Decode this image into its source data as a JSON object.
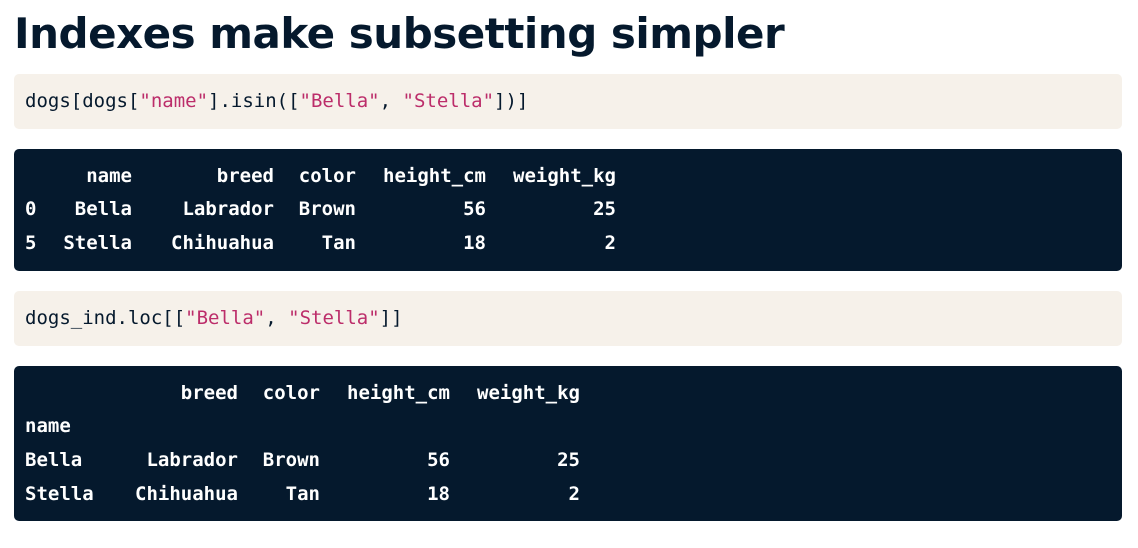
{
  "title": "Indexes make subsetting simpler",
  "code1": {
    "prefix": "dogs[dogs[",
    "key": "\"name\"",
    "mid": "].isin([",
    "val1": "\"Bella\"",
    "sep": ", ",
    "val2": "\"Stella\"",
    "suffix": "])]"
  },
  "output1": {
    "columns": [
      "name",
      "breed",
      "color",
      "height_cm",
      "weight_kg"
    ],
    "rows": [
      {
        "index": "0",
        "name": "Bella",
        "breed": "Labrador",
        "color": "Brown",
        "height_cm": "56",
        "weight_kg": "25"
      },
      {
        "index": "5",
        "name": "Stella",
        "breed": "Chihuahua",
        "color": "Tan",
        "height_cm": "18",
        "weight_kg": "2"
      }
    ]
  },
  "code2": {
    "prefix": "dogs_ind.loc[[",
    "val1": "\"Bella\"",
    "sep": ", ",
    "val2": "\"Stella\"",
    "suffix": "]]"
  },
  "output2": {
    "index_name": "name",
    "columns": [
      "breed",
      "color",
      "height_cm",
      "weight_kg"
    ],
    "rows": [
      {
        "index": "Bella",
        "breed": "Labrador",
        "color": "Brown",
        "height_cm": "56",
        "weight_kg": "25"
      },
      {
        "index": "Stella",
        "breed": "Chihuahua",
        "color": "Tan",
        "height_cm": "18",
        "weight_kg": "2"
      }
    ]
  }
}
